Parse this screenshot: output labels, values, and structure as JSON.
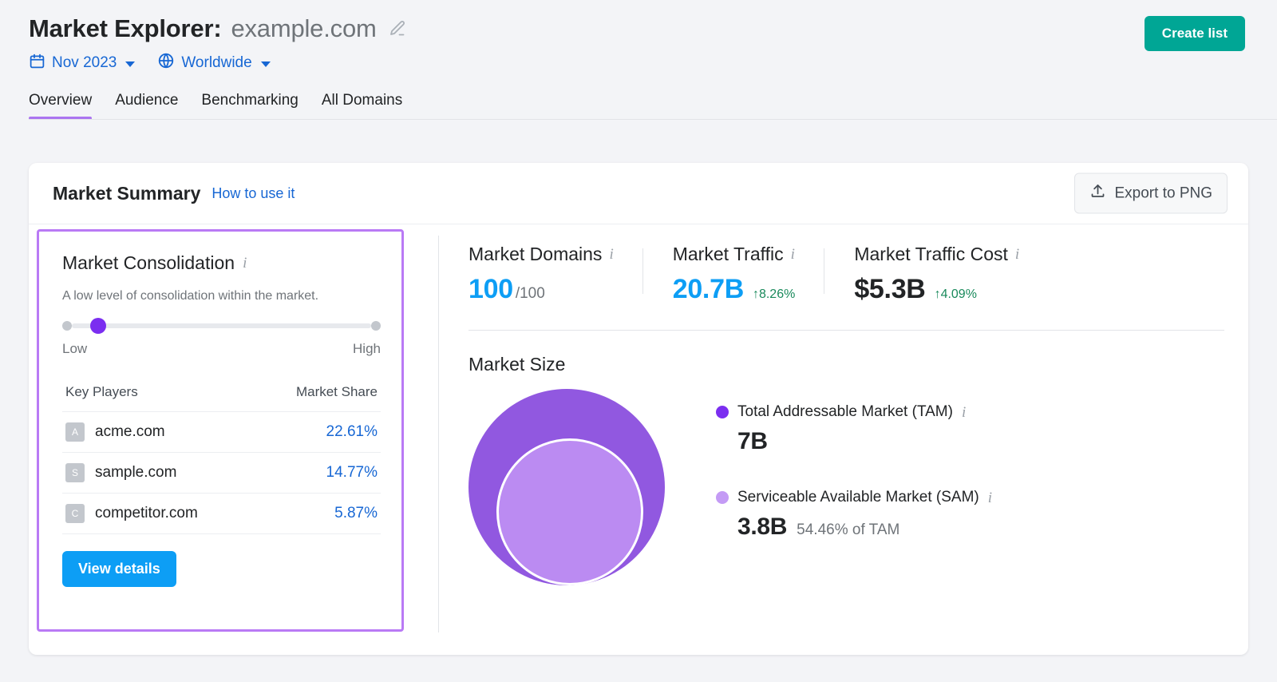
{
  "header": {
    "title_main": "Market Explorer:",
    "title_domain": "example.com",
    "edit_icon": "pencil-icon",
    "create_list_label": "Create list",
    "filters": [
      {
        "icon": "calendar-icon",
        "label": "Nov 2023"
      },
      {
        "icon": "globe-icon",
        "label": "Worldwide"
      }
    ],
    "tabs": [
      {
        "label": "Overview",
        "active": true
      },
      {
        "label": "Audience",
        "active": false
      },
      {
        "label": "Benchmarking",
        "active": false
      },
      {
        "label": "All Domains",
        "active": false
      }
    ]
  },
  "card": {
    "title": "Market Summary",
    "how_to_link": "How to use it",
    "export_label": "Export to PNG",
    "export_icon": "upload-icon"
  },
  "consolidation": {
    "title": "Market Consolidation",
    "info_icon": "info-icon",
    "description": "A low level of consolidation within the market.",
    "slider": {
      "low_label": "Low",
      "high_label": "High",
      "position_percent": 9
    },
    "table": {
      "col_players": "Key Players",
      "col_share": "Market Share",
      "rows": [
        {
          "initial": "A",
          "domain": "acme.com",
          "share": "22.61%"
        },
        {
          "initial": "S",
          "domain": "sample.com",
          "share": "14.77%"
        },
        {
          "initial": "C",
          "domain": "competitor.com",
          "share": "5.87%"
        }
      ]
    },
    "view_details_label": "View details"
  },
  "kpis": [
    {
      "label": "Market Domains",
      "value": "100",
      "suffix": "/100",
      "trend": "",
      "value_color": "blue"
    },
    {
      "label": "Market Traffic",
      "value": "20.7B",
      "suffix": "",
      "trend": "↑8.26%",
      "value_color": "blue"
    },
    {
      "label": "Market Traffic Cost",
      "value": "$5.3B",
      "suffix": "",
      "trend": "↑4.09%",
      "value_color": "dark"
    }
  ],
  "market_size": {
    "title": "Market Size",
    "legend": [
      {
        "label": "Total Addressable Market (TAM)",
        "value": "7B",
        "sub": "",
        "color": "#7b2ef0"
      },
      {
        "label": "Serviceable Available Market (SAM)",
        "value": "3.8B",
        "sub": "54.46% of TAM",
        "color": "#c49bf5"
      }
    ]
  },
  "chart_data": {
    "type": "pie",
    "title": "Market Size",
    "labels": [
      "Total Addressable Market (TAM)",
      "Serviceable Available Market (SAM)"
    ],
    "values": [
      7000000000,
      3800000000
    ],
    "display_values": [
      "7B",
      "3.8B"
    ],
    "sam_share_of_tam_percent": 54.46,
    "colors": [
      "#9158e0",
      "#bb8bf2"
    ],
    "legend_position": "right",
    "note": "Nested proportional circles; SAM inscribed inside TAM"
  },
  "colors": {
    "accent_purple": "#ab75f0",
    "highlight_border": "#b97af5",
    "link_blue": "#1767d4",
    "value_blue": "#0d9ef5",
    "button_teal": "#00a695",
    "trend_green": "#1a8a5c",
    "page_bg": "#f3f4f7"
  }
}
